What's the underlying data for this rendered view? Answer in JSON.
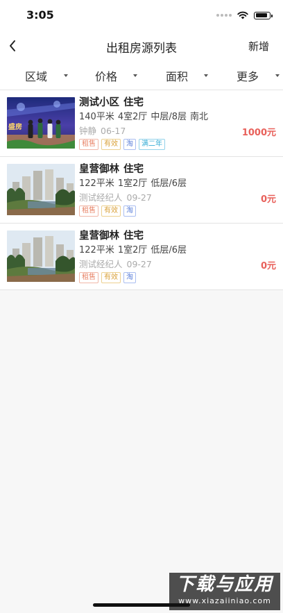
{
  "status_bar": {
    "time": "3:05"
  },
  "nav": {
    "title": "出租房源列表",
    "add_label": "新增"
  },
  "filters": [
    {
      "label": "区域"
    },
    {
      "label": "价格"
    },
    {
      "label": "面积"
    },
    {
      "label": "更多"
    }
  ],
  "listings": [
    {
      "community": "测试小区",
      "property_type": "住宅",
      "area": "140平米",
      "layout": "4室2厅",
      "floor": "中层/8层",
      "orientation": "南北",
      "agent": "钟静",
      "date": "06-17",
      "price": "1000元",
      "tags": [
        {
          "text": "租售",
          "color": "red"
        },
        {
          "text": "有效",
          "color": "orange"
        },
        {
          "text": "淘",
          "color": "blue"
        },
        {
          "text": "满二年",
          "color": "cyan"
        }
      ],
      "thumb_text": "盛房"
    },
    {
      "community": "皇营御林",
      "property_type": "住宅",
      "area": "122平米",
      "layout": "1室2厅",
      "floor": "低层/6层",
      "agent": "测试经纪人",
      "date": "09-27",
      "price": "0元",
      "tags": [
        {
          "text": "租售",
          "color": "red"
        },
        {
          "text": "有效",
          "color": "orange"
        },
        {
          "text": "淘",
          "color": "blue"
        }
      ]
    },
    {
      "community": "皇营御林",
      "property_type": "住宅",
      "area": "122平米",
      "layout": "1室2厅",
      "floor": "低层/6层",
      "agent": "测试经纪人",
      "date": "09-27",
      "price": "0元",
      "tags": [
        {
          "text": "租售",
          "color": "red"
        },
        {
          "text": "有效",
          "color": "orange"
        },
        {
          "text": "淘",
          "color": "blue"
        }
      ]
    }
  ],
  "watermark": {
    "main": "下载与应用",
    "sub": "www.xiazaiiniao.com"
  },
  "colors": {
    "price": "#e8605a",
    "tag_red": "#e8866a",
    "tag_orange": "#d9a13a",
    "tag_blue": "#5b7fd9",
    "tag_cyan": "#3aaed6"
  }
}
